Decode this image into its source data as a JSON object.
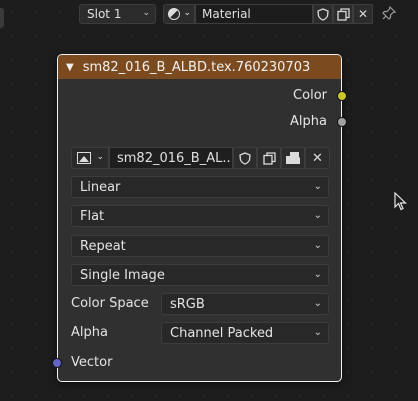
{
  "topbar": {
    "slot_label": "Slot 1",
    "material_name": "Material",
    "material_type_icon": "material-sphere-icon"
  },
  "node": {
    "title": "sm82_016_B_ALBD.tex.760230703",
    "header_color": "#7b4a1f",
    "outputs": [
      {
        "label": "Color",
        "socket_color": "#c7c729"
      },
      {
        "label": "Alpha",
        "socket_color": "#a1a1a1"
      }
    ],
    "image": {
      "name": "sm82_016_B_AL...",
      "type_icon": "image-icon"
    },
    "interpolation": "Linear",
    "projection": "Flat",
    "extension": "Repeat",
    "source": "Single Image",
    "color_space": {
      "label": "Color Space",
      "value": "sRGB"
    },
    "alpha": {
      "label": "Alpha",
      "value": "Channel Packed"
    },
    "inputs": [
      {
        "label": "Vector",
        "socket_color": "#6363c7"
      }
    ]
  }
}
